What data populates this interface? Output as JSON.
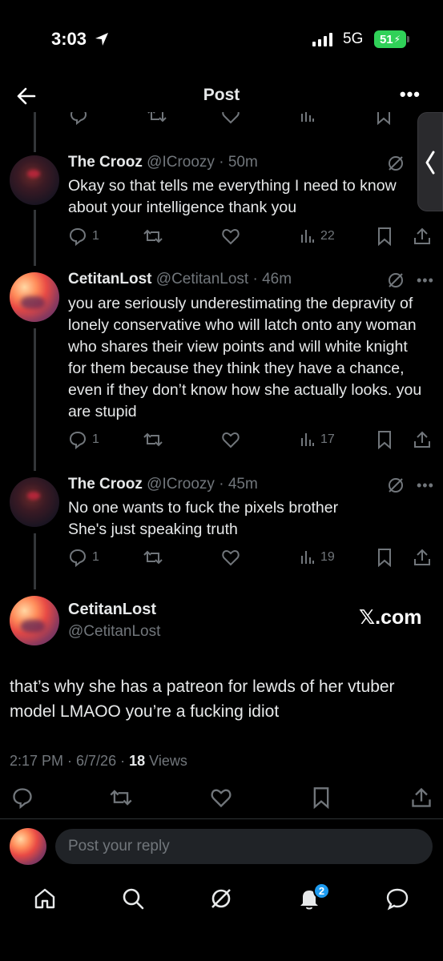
{
  "status": {
    "time": "3:03",
    "network": "5G",
    "battery": "51"
  },
  "header": {
    "title": "Post"
  },
  "thread": [
    {
      "name": "The Crooz",
      "handle": "@ICroozy",
      "time": "50m",
      "text": "Okay so that tells me everything I need to know about your intelligence thank you",
      "replies": "1",
      "views": "22"
    },
    {
      "name": "CetitanLost",
      "handle": "@CetitanLost",
      "time": "46m",
      "text": "you are seriously underestimating the depravity of lonely conservative who will latch onto any woman who shares their view points and will white knight for them because they think they have a chance, even if they don’t know how she actually looks. you are stupid",
      "replies": "1",
      "views": "17"
    },
    {
      "name": "The Crooz",
      "handle": "@ICroozy",
      "time": "45m",
      "text": "No one wants to fuck the pixels brother She's just speaking truth",
      "replies": "1",
      "views": "19"
    }
  ],
  "main_post": {
    "name": "CetitanLost",
    "handle": "@CetitanLost",
    "watermark": "𝕏.com",
    "text": "that’s why she has a patreon for lewds of her vtuber model LMAOO you’re a fucking idiot",
    "timestamp": "2:17 PM · 6/7/26 ·",
    "views_count": "18",
    "views_label": "Views"
  },
  "reply": {
    "placeholder": "Post your reply"
  },
  "tabbar": {
    "notification_count": "2"
  },
  "colors": {
    "background": "#000000",
    "text": "#e7e9ea",
    "muted": "#71767b",
    "accent": "#1d9bf0",
    "battery": "#30d158"
  }
}
